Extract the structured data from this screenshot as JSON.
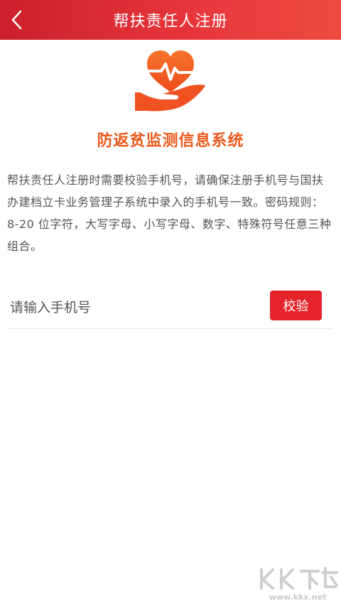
{
  "header": {
    "title": "帮扶责任人注册",
    "back_icon": "chevron-left-icon"
  },
  "brand": {
    "logo_icon": "heart-pulse-hand-icon",
    "system_name": "防返贫监测信息系统"
  },
  "notice": {
    "text": "帮扶责任人注册时需要校验手机号，请确保注册手机号与国扶办建档立卡业务管理子系统中录入的手机号一致。密码规则：8-20 位字符，大写字母、小写字母、数字、特殊符号任意三种组合。"
  },
  "phone": {
    "placeholder": "请输入手机号",
    "value": "",
    "verify_label": "校验"
  },
  "watermark": {
    "url": "www.kkx.net"
  },
  "colors": {
    "header_red": "#e4232b",
    "accent_orange": "#ea5a1c",
    "button_red": "#e4232b"
  }
}
